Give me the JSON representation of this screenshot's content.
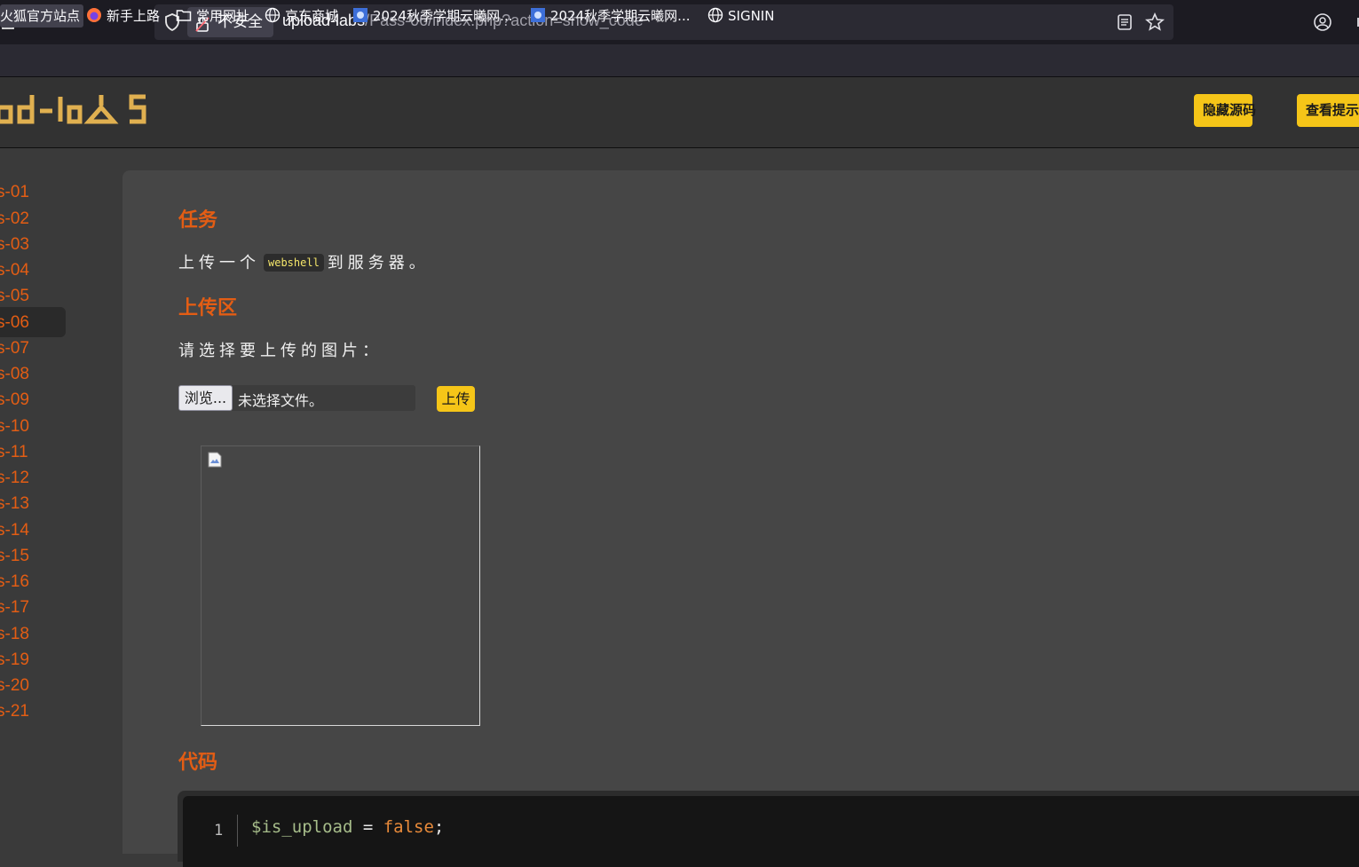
{
  "browser": {
    "insecure_label": "不安全",
    "url_host": "upload-labs",
    "url_path": "/Pass-06/index.php?action=show_code",
    "icons": [
      "home-icon",
      "shield-icon",
      "insecure-lock-icon",
      "reader-view-icon",
      "bookmark-star-icon",
      "account-icon",
      "menu-icon"
    ]
  },
  "bookmarks": [
    {
      "label": "火狐官方站点",
      "icon": "none"
    },
    {
      "label": "新手上路",
      "icon": "firefox-icon"
    },
    {
      "label": "常用网址",
      "icon": "folder-icon"
    },
    {
      "label": "京东商城",
      "icon": "globe-icon"
    },
    {
      "label": "2024秋季学期云曦网...",
      "icon": "site-favicon"
    },
    {
      "label": "2024秋季学期云曦网...",
      "icon": "site-favicon"
    },
    {
      "label": "SIGNIN",
      "icon": "globe-icon"
    }
  ],
  "header": {
    "logo_text": "od-lo⅄S",
    "hide_source_label": "隐藏源码",
    "view_hint_label": "查看提示"
  },
  "sidebar": {
    "items": [
      "s-01",
      "s-02",
      "s-03",
      "s-04",
      "s-05",
      "s-06",
      "s-07",
      "s-08",
      "s-09",
      "s-10",
      "s-11",
      "s-12",
      "s-13",
      "s-14",
      "s-15",
      "s-16",
      "s-17",
      "s-18",
      "s-19",
      "s-20",
      "s-21"
    ],
    "active_index": 5
  },
  "main": {
    "task_title": "任务",
    "task_prefix": "上传一个",
    "task_code": "webshell",
    "task_suffix": "到服务器。",
    "upload_title": "上传区",
    "upload_prompt": "请选择要上传的图片：",
    "browse_label": "浏览...",
    "file_status": "未选择文件。",
    "upload_label": "上传",
    "code_title": "代码",
    "code_line_number": "1",
    "code_var": "$is_upload",
    "code_op": " = ",
    "code_value": "false",
    "code_end": ";"
  },
  "colors": {
    "accent_orange": "#e35d14",
    "button_yellow": "#f5c518",
    "panel_bg": "#464646",
    "page_bg": "#3a3a3a"
  }
}
